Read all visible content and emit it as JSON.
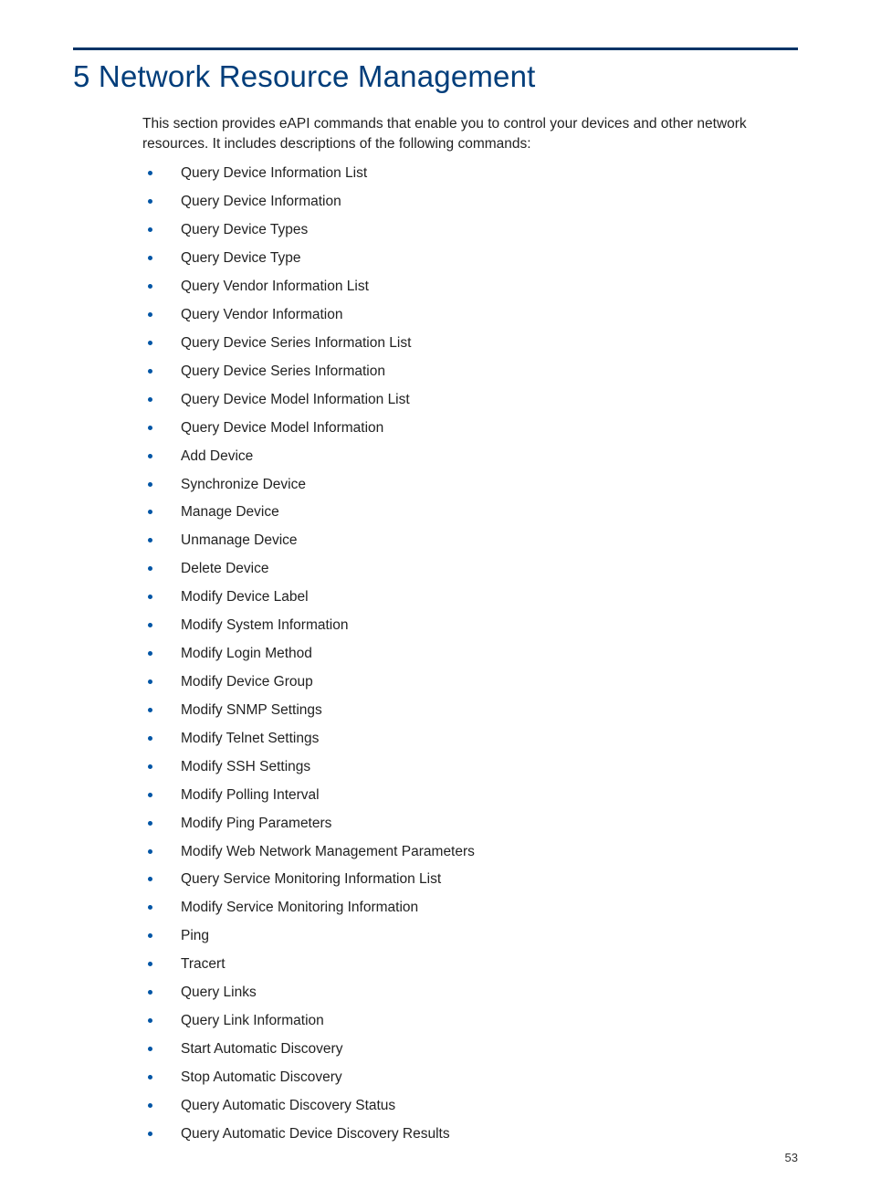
{
  "heading": "5 Network Resource Management",
  "intro": "This section provides eAPI commands that enable you to control your devices and other network resources. It includes descriptions of the following commands:",
  "commands": [
    "Query Device Information List",
    "Query Device Information",
    "Query Device Types",
    "Query Device Type",
    "Query Vendor Information List",
    "Query Vendor Information",
    "Query Device Series Information List",
    "Query Device Series Information",
    "Query Device Model Information List",
    "Query Device Model Information",
    "Add Device",
    "Synchronize Device",
    "Manage Device",
    "Unmanage Device",
    "Delete Device",
    "Modify Device Label",
    "Modify System Information",
    "Modify Login Method",
    "Modify Device Group",
    "Modify SNMP Settings",
    "Modify Telnet Settings",
    "Modify SSH Settings",
    "Modify Polling Interval",
    "Modify Ping Parameters",
    "Modify Web Network Management Parameters",
    "Query Service Monitoring Information List",
    "Modify Service Monitoring Information",
    "Ping",
    "Tracert",
    "Query Links",
    "Query Link Information",
    "Start Automatic Discovery",
    "Stop Automatic Discovery",
    "Query Automatic Discovery Status",
    "Query Automatic Device Discovery Results"
  ],
  "page_number": "53"
}
